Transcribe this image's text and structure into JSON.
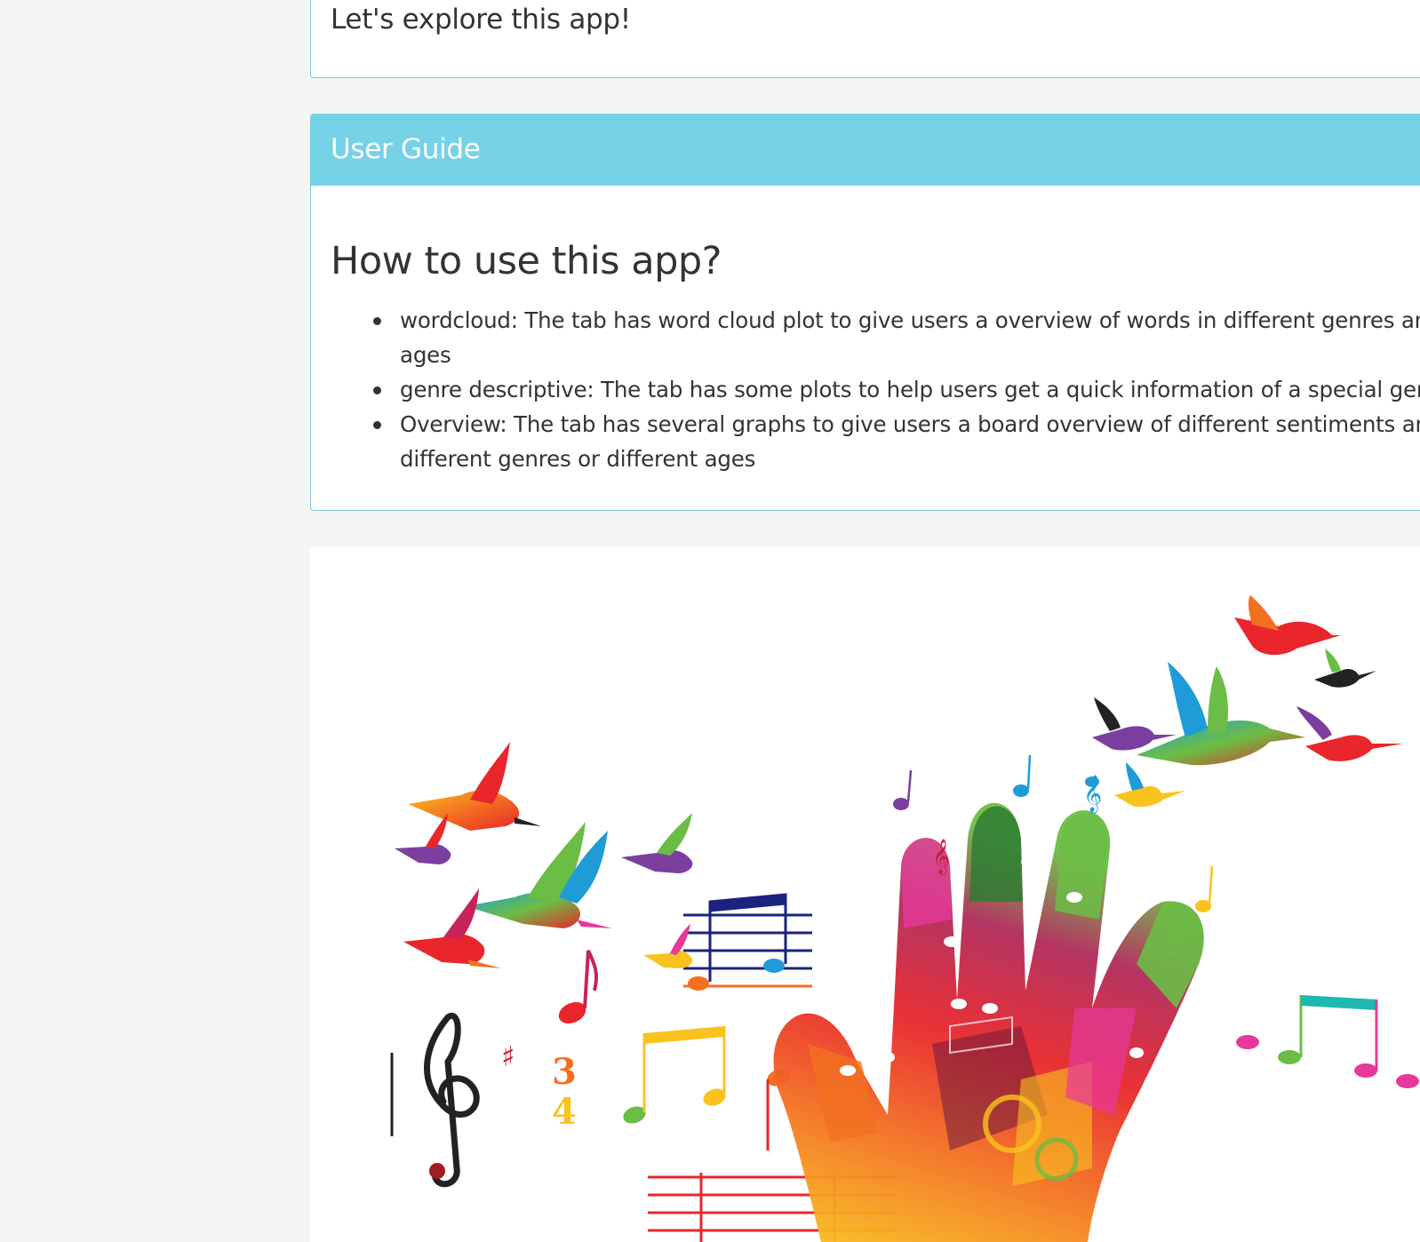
{
  "intro": {
    "text": "Let's explore this app!"
  },
  "user_guide": {
    "title": "User Guide",
    "heading": "How to use this app?",
    "items": [
      {
        "line1": "wordcloud: The tab has word cloud plot to give users a overview of words in different genres and",
        "line2": "ages"
      },
      {
        "line1": "genre descriptive: The tab has some plots to help users get a quick information of a special genre",
        "line2": ""
      },
      {
        "line1": "Overview: The tab has several graphs to give users a board overview of different sentiments among",
        "line2": "different genres or different ages"
      }
    ]
  },
  "illustration": {
    "subject": "colorful hand with musical notes and hummingbirds",
    "colors": {
      "red": "#e8262b",
      "orange": "#f37021",
      "yellow": "#f9c31f",
      "green": "#6cbd45",
      "blue": "#1f9cd8",
      "purple": "#7b3fa0",
      "pink": "#e6399b",
      "dark": "#222222"
    }
  },
  "theme": {
    "accent": "#76d2e6",
    "border": "#7ec8dd",
    "background": "#f4f6f6"
  }
}
